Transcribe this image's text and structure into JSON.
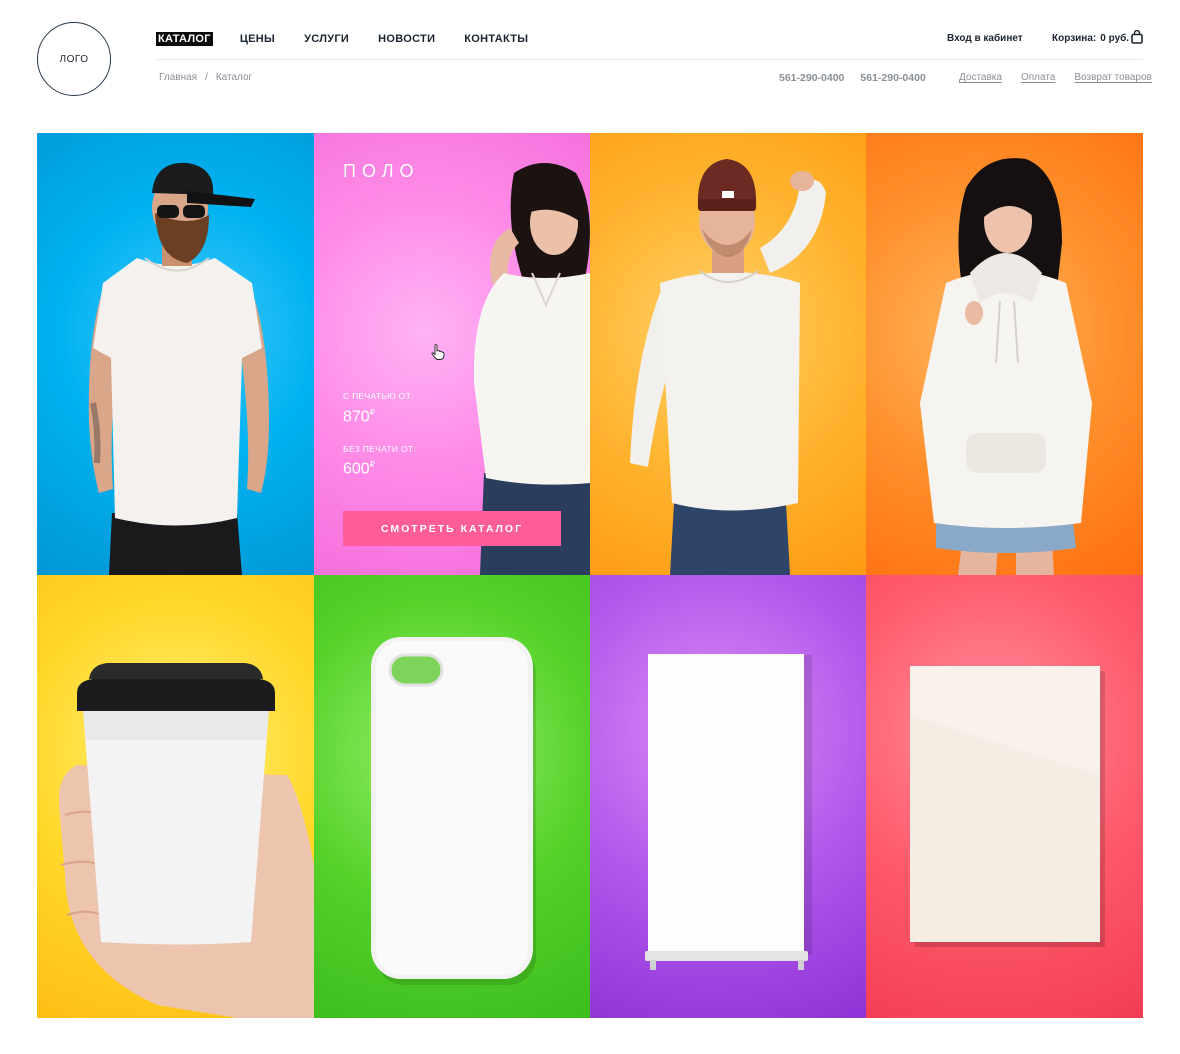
{
  "logo": {
    "text": "ЛОГО"
  },
  "nav": {
    "items": [
      {
        "label": "КАТАЛОГ",
        "active": true
      },
      {
        "label": "ЦЕНЫ",
        "active": false
      },
      {
        "label": "УСЛУГИ",
        "active": false
      },
      {
        "label": "НОВОСТИ",
        "active": false
      },
      {
        "label": "КОНТАКТЫ",
        "active": false
      }
    ]
  },
  "header": {
    "cabinet_label": "Вход в кабинет",
    "cart_label": "Корзина:",
    "cart_value": "0 руб.",
    "cart_icon": "shopping-bag-icon"
  },
  "breadcrumb": {
    "home": "Главная",
    "separator": "/",
    "current": "Каталог"
  },
  "phones": [
    "561-290-0400",
    "561-290-0400"
  ],
  "links": [
    "Доставка",
    "Оплата",
    "Возврат товаров"
  ],
  "promo": {
    "title": "ПОЛО",
    "with_print_label": "С ПЕЧАТЬЮ ОТ:",
    "with_print_price": "870",
    "without_print_label": "БЕЗ ПЕЧАТИ ОТ:",
    "without_print_price": "600",
    "currency": "₽",
    "button_label": "СМОТРЕТЬ КАТАЛОГ"
  },
  "tiles": [
    {
      "item": "t-shirt",
      "color": "#00b2f0"
    },
    {
      "item": "polo",
      "color": "#ff8be8"
    },
    {
      "item": "longsleeve",
      "color": "#ffb42f"
    },
    {
      "item": "hoodie",
      "color": "#ff8f2a"
    },
    {
      "item": "paper-cup",
      "color": "#ffd82a"
    },
    {
      "item": "phone-case",
      "color": "#55d22a"
    },
    {
      "item": "roll-up-banner",
      "color": "#b158ec"
    },
    {
      "item": "poster",
      "color": "#ff5a6c"
    }
  ]
}
